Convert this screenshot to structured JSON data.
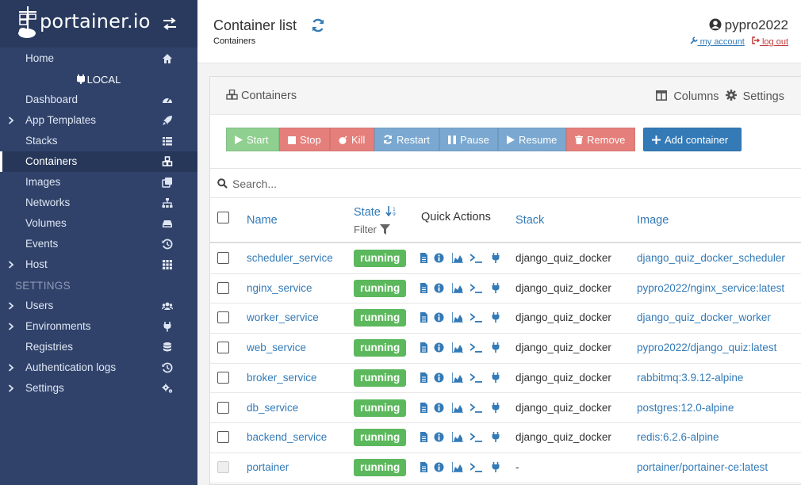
{
  "brand": {
    "name": "portainer.io"
  },
  "sidebar": {
    "home": "Home",
    "endpoint": "LOCAL",
    "items": [
      {
        "label": "Dashboard",
        "icon": "tachometer-icon",
        "chevron": false
      },
      {
        "label": "App Templates",
        "icon": "rocket-icon",
        "chevron": true
      },
      {
        "label": "Stacks",
        "icon": "th-list-icon",
        "chevron": false
      },
      {
        "label": "Containers",
        "icon": "cubes-icon",
        "chevron": false,
        "active": true
      },
      {
        "label": "Images",
        "icon": "clone-icon",
        "chevron": false
      },
      {
        "label": "Networks",
        "icon": "sitemap-icon",
        "chevron": false
      },
      {
        "label": "Volumes",
        "icon": "hdd-icon",
        "chevron": false
      },
      {
        "label": "Events",
        "icon": "history-icon",
        "chevron": false
      },
      {
        "label": "Host",
        "icon": "th-icon",
        "chevron": true
      }
    ],
    "settings_heading": "SETTINGS",
    "settings_items": [
      {
        "label": "Users",
        "icon": "users-icon",
        "chevron": true
      },
      {
        "label": "Environments",
        "icon": "plug-icon",
        "chevron": true
      },
      {
        "label": "Registries",
        "icon": "database-icon",
        "chevron": false
      },
      {
        "label": "Authentication logs",
        "icon": "history-icon",
        "chevron": true
      },
      {
        "label": "Settings",
        "icon": "cogs-icon",
        "chevron": true
      }
    ]
  },
  "header": {
    "title": "Container list",
    "breadcrumb": "Containers",
    "username": "pypro2022",
    "my_account": "my account",
    "log_out": "log out"
  },
  "panel": {
    "title": "Containers",
    "columns_label": "Columns",
    "settings_label": "Settings"
  },
  "toolbar": {
    "start": "Start",
    "stop": "Stop",
    "kill": "Kill",
    "restart": "Restart",
    "pause": "Pause",
    "resume": "Resume",
    "remove": "Remove",
    "add": "Add container"
  },
  "search": {
    "placeholder": "Search..."
  },
  "table": {
    "headers": {
      "name": "Name",
      "state": "State",
      "filter": "Filter",
      "quick_actions": "Quick Actions",
      "stack": "Stack",
      "image": "Image"
    },
    "rows": [
      {
        "name": "scheduler_service",
        "state": "running",
        "stack": "django_quiz_docker",
        "image": "django_quiz_docker_scheduler"
      },
      {
        "name": "nginx_service",
        "state": "running",
        "stack": "django_quiz_docker",
        "image": "pypro2022/nginx_service:latest"
      },
      {
        "name": "worker_service",
        "state": "running",
        "stack": "django_quiz_docker",
        "image": "django_quiz_docker_worker"
      },
      {
        "name": "web_service",
        "state": "running",
        "stack": "django_quiz_docker",
        "image": "pypro2022/django_quiz:latest"
      },
      {
        "name": "broker_service",
        "state": "running",
        "stack": "django_quiz_docker",
        "image": "rabbitmq:3.9.12-alpine"
      },
      {
        "name": "db_service",
        "state": "running",
        "stack": "django_quiz_docker",
        "image": "postgres:12.0-alpine"
      },
      {
        "name": "backend_service",
        "state": "running",
        "stack": "django_quiz_docker",
        "image": "redis:6.2.6-alpine"
      },
      {
        "name": "portainer",
        "state": "running",
        "stack": "-",
        "image": "portainer/portainer-ce:latest"
      }
    ]
  },
  "colors": {
    "sidebar": "#30426a",
    "accent": "#337ab7",
    "running": "#5cb85c",
    "danger": "#e57f7b"
  }
}
